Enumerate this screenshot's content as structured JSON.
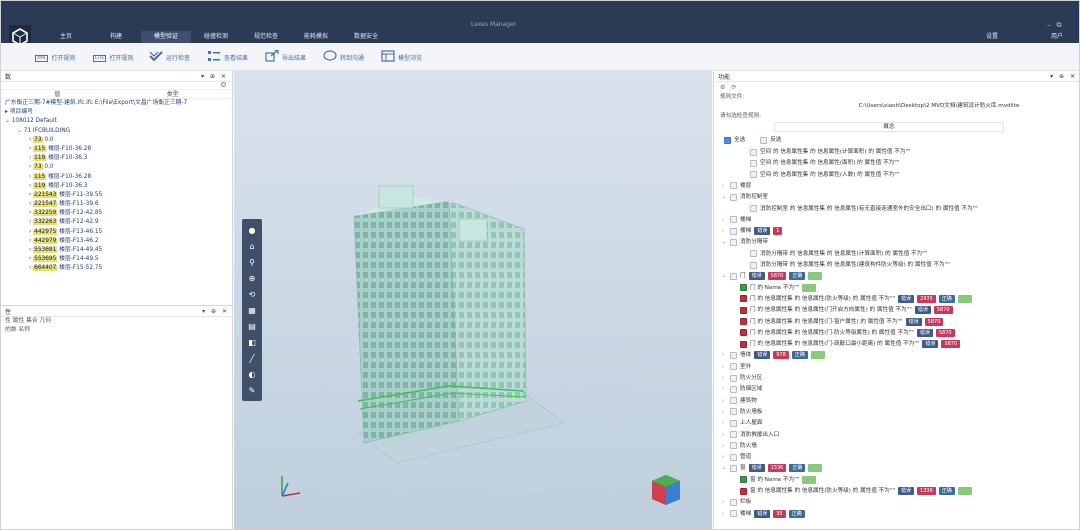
{
  "app": {
    "title": "Lexes Manager",
    "settings_label": "设置",
    "user_label": "用户"
  },
  "tabs": [
    {
      "label": "主页",
      "active": false
    },
    {
      "label": "构建",
      "active": false
    },
    {
      "label": "模型验证",
      "active": true
    },
    {
      "label": "碰撞检测",
      "active": false
    },
    {
      "label": "规范检查",
      "active": false
    },
    {
      "label": "能耗模拟",
      "active": false
    },
    {
      "label": "数据安全",
      "active": false
    }
  ],
  "toolbar": [
    {
      "label": "打开规则",
      "icon": "xml-file-icon",
      "tag": "XML"
    },
    {
      "label": "打开规则",
      "icon": "lite-file-icon",
      "tag": "LITE"
    },
    {
      "label": "运行检查",
      "icon": "run-check-icon"
    },
    {
      "label": "查看结果",
      "icon": "view-results-icon"
    },
    {
      "label": "导出结果",
      "icon": "export-icon"
    },
    {
      "label": "转到沟通",
      "icon": "comment-icon"
    },
    {
      "label": "模型浏览",
      "icon": "model-browse-icon"
    }
  ],
  "left_pane": {
    "title": "数",
    "controls": "▾ ⊕ ✕",
    "columns": [
      "值",
      "类型"
    ],
    "path_row": "广东衡正三期-7#模型-建筑.ifc.ifc E:\\File\\Export\\文昌广场衡正三期-7",
    "tree": [
      {
        "indent": 0,
        "text": "▸ 项目编号"
      },
      {
        "indent": 0,
        "text": "⌄ 108012 Default"
      },
      {
        "indent": 1,
        "text": "⌄ 71 IFCBUILDING"
      },
      {
        "indent": 2,
        "id": "73",
        "text": "0.0"
      },
      {
        "indent": 2,
        "id": "115",
        "text": "楼层-F10-36.28"
      },
      {
        "indent": 2,
        "id": "119",
        "text": "楼层-F10-36.3"
      },
      {
        "indent": 2,
        "id": "73",
        "text": "0.0"
      },
      {
        "indent": 2,
        "id": "115",
        "text": "楼层-F10-36.28"
      },
      {
        "indent": 2,
        "id": "119",
        "text": "楼层-F10-36.3"
      },
      {
        "indent": 2,
        "id": "221543",
        "text": "楼层-F11-39.55"
      },
      {
        "indent": 2,
        "id": "221547",
        "text": "楼层-F11-39.6"
      },
      {
        "indent": 2,
        "id": "332259",
        "text": "楼层-F12-42.85"
      },
      {
        "indent": 2,
        "id": "332263",
        "text": "楼层-F12-42.9"
      },
      {
        "indent": 2,
        "id": "442975",
        "text": "楼层-F13-46.15"
      },
      {
        "indent": 2,
        "id": "442979",
        "text": "楼层-F13-46.2"
      },
      {
        "indent": 2,
        "id": "553691",
        "text": "楼层-F14-49.45"
      },
      {
        "indent": 2,
        "id": "553695",
        "text": "楼层-F14-49.5"
      },
      {
        "indent": 2,
        "id": "664407",
        "text": "楼层-F15-52.75"
      }
    ]
  },
  "lower_pane": {
    "title": "性",
    "controls": "▾ ⊕ ✕",
    "line1": "性 属性 集合 几何",
    "line2": "的数   名称"
  },
  "viewport": {
    "tools": [
      "point-icon",
      "home-icon",
      "zoom-icon",
      "zoom-fit-icon",
      "orbit-icon",
      "grid-icon",
      "layers-icon",
      "section-icon",
      "measure-icon",
      "visibility-icon",
      "annotation-icon"
    ]
  },
  "right_pane": {
    "title": "功能",
    "controls": "▾ ⊕ ✕",
    "file_label": "规则文件:",
    "file_path": "C:\\Users\\xiaoh\\Desktop\\2 MVD文档\\建筑设计防火库.mvdlite",
    "rules_label": "请勾选检查规则:",
    "mode_value": "概念",
    "select_all": "全选",
    "select_none": "反选",
    "rows": [
      {
        "indent": 2,
        "cb": "off",
        "text": "空间 的 信息属性集 的 信息属性(计算面积) 的 属性值 不为\"\""
      },
      {
        "indent": 2,
        "cb": "off",
        "text": "空间 的 信息属性集 的 信息属性(面积) 的 属性值 不为\"\""
      },
      {
        "indent": 2,
        "cb": "off",
        "text": "空间 的 信息属性集 的 信息属性(人数) 的 属性值 不为\"\""
      },
      {
        "indent": 0,
        "cb": "off",
        "arrow": "›",
        "text": "楼层"
      },
      {
        "indent": 0,
        "cb": "off",
        "arrow": "⌄",
        "text": "消防控制室"
      },
      {
        "indent": 2,
        "cb": "off",
        "text": "消防控制室 的 信息属性集 的 信息属性(有无直接连通室外的安全出口) 的 属性值 不为\"\""
      },
      {
        "indent": 0,
        "cb": "off",
        "arrow": "›",
        "text": "楼梯"
      },
      {
        "indent": 0,
        "cb": "off",
        "arrow": "›",
        "text": "楼梯",
        "badges": [
          {
            "t": "错误",
            "c": "b-err"
          },
          {
            "t": "1",
            "c": "b-cnt"
          }
        ]
      },
      {
        "indent": 0,
        "cb": "off",
        "arrow": "⌄",
        "text": "消防分隔带"
      },
      {
        "indent": 2,
        "cb": "off",
        "text": "消防分隔带 的 信息属性集 的 信息属性(计算面积) 的 属性值 不为\"\""
      },
      {
        "indent": 2,
        "cb": "off",
        "text": "消防分隔带 的 信息属性集 的 信息属性(建筑构件防火等级) 的 属性值 不为\"\""
      },
      {
        "indent": 0,
        "cb": "off",
        "arrow": "⌄",
        "text": "门",
        "badges": [
          {
            "t": "错误",
            "c": "b-err"
          },
          {
            "t": "5870",
            "c": "b-cnt"
          },
          {
            "t": "正确",
            "c": "b-ok"
          },
          {
            "t": "",
            "c": "b-pass"
          }
        ]
      },
      {
        "indent": 1,
        "cb": "green",
        "text": "门 的 Name 不为\"\"",
        "badges": [
          {
            "t": "",
            "c": "b-pass"
          }
        ]
      },
      {
        "indent": 1,
        "cb": "red",
        "text": "门 的 信息属性集 的 信息属性(防火等级) 的 属性值 不为\"\"",
        "badges": [
          {
            "t": "错误",
            "c": "b-err"
          },
          {
            "t": "2935",
            "c": "b-cnt"
          },
          {
            "t": "正确",
            "c": "b-ok"
          },
          {
            "t": "",
            "c": "b-pass"
          }
        ]
      },
      {
        "indent": 1,
        "cb": "red",
        "text": "门 的 信息属性集 的 信息属性(门开启方向属性) 的 属性值 不为\"\"",
        "badges": [
          {
            "t": "错误",
            "c": "b-err"
          },
          {
            "t": "5870",
            "c": "b-cnt"
          }
        ]
      },
      {
        "indent": 1,
        "cb": "red",
        "text": "门 的 信息属性集 的 信息属性(门-窗户属性) 的 属性值 不为\"\"",
        "badges": [
          {
            "t": "错误",
            "c": "b-err"
          },
          {
            "t": "5870",
            "c": "b-cnt"
          }
        ]
      },
      {
        "indent": 1,
        "cb": "red",
        "text": "门 的 信息属性集 的 信息属性(门-防火等级属性) 的 属性值 不为\"\"",
        "badges": [
          {
            "t": "错误",
            "c": "b-err"
          },
          {
            "t": "5870",
            "c": "b-cnt"
          }
        ]
      },
      {
        "indent": 1,
        "cb": "red",
        "text": "门 的 信息属性集 的 信息属性(门-疏散口最小距离) 的 属性值 不为\"\"",
        "badges": [
          {
            "t": "错误",
            "c": "b-err"
          },
          {
            "t": "5870",
            "c": "b-cnt"
          }
        ]
      },
      {
        "indent": 0,
        "cb": "off",
        "arrow": "›",
        "text": "墙体",
        "badges": [
          {
            "t": "错误",
            "c": "b-err"
          },
          {
            "t": "978",
            "c": "b-cnt"
          },
          {
            "t": "正确",
            "c": "b-ok"
          },
          {
            "t": "",
            "c": "b-pass"
          }
        ]
      },
      {
        "indent": 0,
        "cb": "off",
        "arrow": "›",
        "text": "室外"
      },
      {
        "indent": 0,
        "cb": "off",
        "arrow": "›",
        "text": "防火分区"
      },
      {
        "indent": 0,
        "cb": "off",
        "arrow": "›",
        "text": "防烟区域"
      },
      {
        "indent": 0,
        "cb": "off",
        "arrow": "›",
        "text": "建筑物"
      },
      {
        "indent": 0,
        "cb": "off",
        "arrow": "›",
        "text": "防火墙板"
      },
      {
        "indent": 0,
        "cb": "off",
        "arrow": "›",
        "text": "上人屋面"
      },
      {
        "indent": 0,
        "cb": "off",
        "arrow": "›",
        "text": "消防救援出入口"
      },
      {
        "indent": 0,
        "cb": "off",
        "arrow": "›",
        "text": "防火墙"
      },
      {
        "indent": 0,
        "cb": "off",
        "arrow": "›",
        "text": "管道"
      },
      {
        "indent": 0,
        "cb": "off",
        "arrow": "⌄",
        "text": "窗",
        "badges": [
          {
            "t": "错误",
            "c": "b-err"
          },
          {
            "t": "1336",
            "c": "b-cnt"
          },
          {
            "t": "正确",
            "c": "b-ok"
          },
          {
            "t": "",
            "c": "b-pass"
          }
        ]
      },
      {
        "indent": 1,
        "cb": "green",
        "text": "窗 的 Name 不为\"\"",
        "badges": [
          {
            "t": "",
            "c": "b-pass"
          }
        ]
      },
      {
        "indent": 1,
        "cb": "red",
        "text": "窗 的 信息属性集 的 信息属性(防火等级) 的 属性值 不为\"\"",
        "badges": [
          {
            "t": "错误",
            "c": "b-err"
          },
          {
            "t": "1336",
            "c": "b-cnt"
          },
          {
            "t": "正确",
            "c": "b-ok"
          },
          {
            "t": "",
            "c": "b-pass"
          }
        ]
      },
      {
        "indent": 0,
        "cb": "off",
        "arrow": "›",
        "text": "栏板"
      },
      {
        "indent": 0,
        "cb": "off",
        "arrow": "›",
        "text": "楼梯",
        "badges": [
          {
            "t": "错误",
            "c": "b-err"
          },
          {
            "t": "35",
            "c": "b-cnt"
          },
          {
            "t": "正确",
            "c": "b-ok"
          }
        ]
      }
    ]
  },
  "colors": {
    "titlebar": "#2b3a55",
    "accent": "#4a6fa5",
    "error_badge": "#c63a5d",
    "pass_badge": "#8bc87a"
  }
}
